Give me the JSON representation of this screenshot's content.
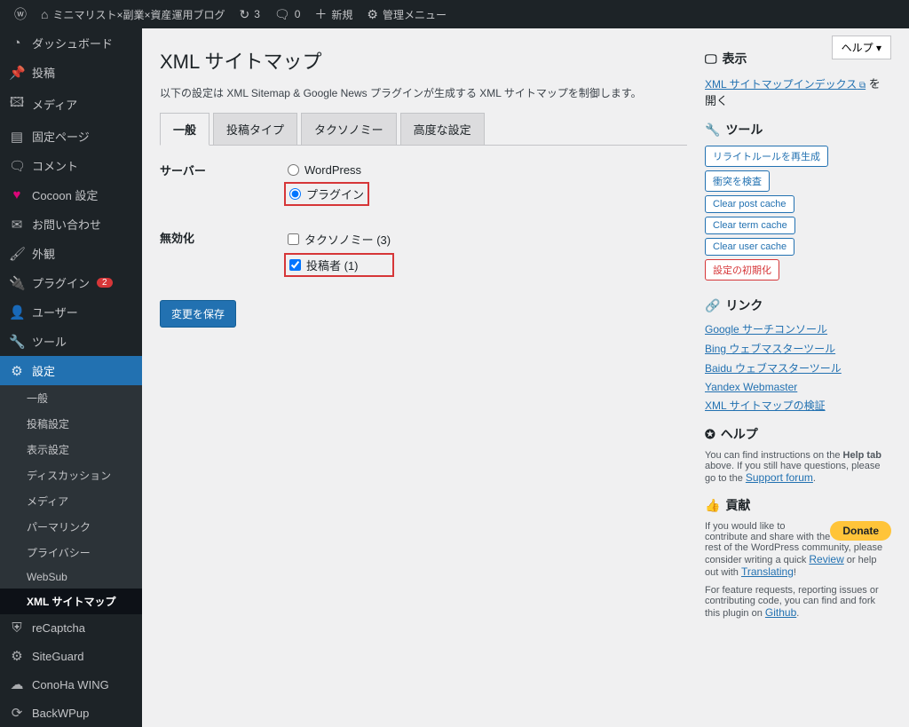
{
  "adminbar": {
    "site": "ミニマリスト×副業×資産運用ブログ",
    "updates": "3",
    "comments": "0",
    "new": "新規",
    "admin_menu": "管理メニュー"
  },
  "sidebar": {
    "dashboard": "ダッシュボード",
    "posts": "投稿",
    "media": "メディア",
    "pages": "固定ページ",
    "comments": "コメント",
    "cocoon": "Cocoon 設定",
    "contact": "お問い合わせ",
    "appearance": "外観",
    "plugins": "プラグイン",
    "plugins_badge": "2",
    "users": "ユーザー",
    "tools": "ツール",
    "settings": "設定",
    "sub": {
      "general": "一般",
      "writing": "投稿設定",
      "reading": "表示設定",
      "discussion": "ディスカッション",
      "media": "メディア",
      "permalink": "パーマリンク",
      "privacy": "プライバシー",
      "websub": "WebSub",
      "xmlsitemap": "XML サイトマップ"
    },
    "recaptcha": "reCaptcha",
    "siteguard": "SiteGuard",
    "conoha": "ConoHa WING",
    "backwpup": "BackWPup"
  },
  "help_button": "ヘルプ ▾",
  "page": {
    "title": "XML サイトマップ",
    "desc": "以下の設定は XML Sitemap & Google News プラグインが生成する XML サイトマップを制御します。",
    "tabs": {
      "general": "一般",
      "post_types": "投稿タイプ",
      "taxonomies": "タクソノミー",
      "advanced": "高度な設定"
    },
    "server": {
      "label": "サーバー",
      "wordpress": "WordPress",
      "plugin": "プラグイン"
    },
    "disable": {
      "label": "無効化",
      "taxonomies": "タクソノミー (3)",
      "authors": "投稿者 (1)"
    },
    "save": "変更を保存"
  },
  "side": {
    "display_h": "表示",
    "index_link": "XML サイトマップインデックス",
    "index_suffix": "を開く",
    "tools_h": "ツール",
    "tools": {
      "rewrite": "リライトルールを再生成",
      "conflict": "衝突を検査",
      "clear_post": "Clear post cache",
      "clear_term": "Clear term cache",
      "clear_user": "Clear user cache",
      "reset": "設定の初期化"
    },
    "links_h": "リンク",
    "links": {
      "google": "Google サーチコンソール",
      "bing": "Bing ウェブマスターツール",
      "baidu": "Baidu ウェブマスターツール",
      "yandex": "Yandex Webmaster",
      "validate": "XML サイトマップの検証"
    },
    "help_h": "ヘルプ",
    "help_text1": "You can find instructions on the ",
    "help_text2": "Help tab",
    "help_text3": " above. If you still have questions, please go to the ",
    "help_link": "Support forum",
    "contribute_h": "貢献",
    "contribute_text1": "If you would like to contribute and share with the rest of the WordPress community, please consider writing a quick ",
    "review": "Review",
    "contribute_text2": " or help out with ",
    "translating": "Translating",
    "contribute_text3": "!",
    "feature_text": "For feature requests, reporting issues or contributing code, you can find and fork this plugin on ",
    "github": "Github",
    "donate": "Donate"
  }
}
